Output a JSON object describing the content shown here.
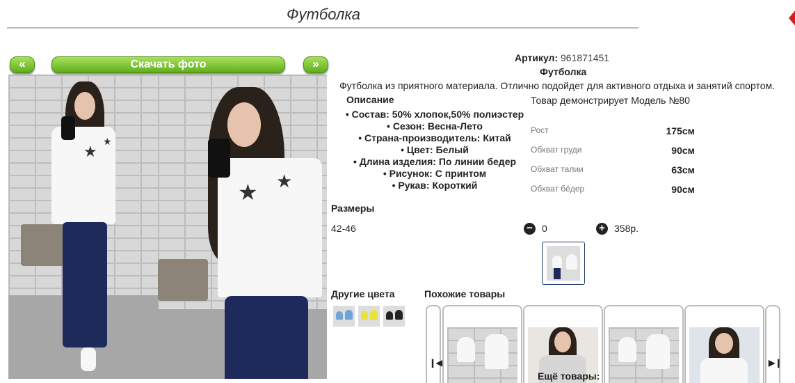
{
  "page_title": "Футболка",
  "nav": {
    "prev_label": "«",
    "next_label": "»",
    "download_label": "Скачать фото"
  },
  "product": {
    "article_label": "Артикул:",
    "article_value": "961871451",
    "name": "Футболка",
    "intro": "Футболка из приятного материала. Отлично подойдет для активного отдыха и занятий спортом.",
    "description_heading": "Описание",
    "attributes": [
      "Состав: 50% хлопок,50% полиэстер",
      "Сезон: Весна-Лето",
      "Страна-производитель: Китай",
      "Цвет: Белый",
      "Длина изделия: По линии бедер",
      "Рисунок: С принтом",
      "Рукав: Короткий"
    ],
    "model_note": "Товар демонстрирует Модель №80",
    "measurements": [
      {
        "label": "Рост",
        "value": "175см"
      },
      {
        "label": "Обхват груди",
        "value": "90см"
      },
      {
        "label": "Обхват талии",
        "value": "63см"
      },
      {
        "label": "Обхват бёдер",
        "value": "90см"
      }
    ]
  },
  "sizes": {
    "heading": "Размеры",
    "rows": [
      {
        "size": "42-46",
        "qty": "0",
        "price": "358р."
      }
    ]
  },
  "other_colors_heading": "Другие цвета",
  "similar_heading": "Похожие товары",
  "more_label": "Ещё товары:",
  "colors": {
    "accent_green": "#5fae1c",
    "thumb_border": "#1a3a6a",
    "star_red": "#d21f1f"
  }
}
